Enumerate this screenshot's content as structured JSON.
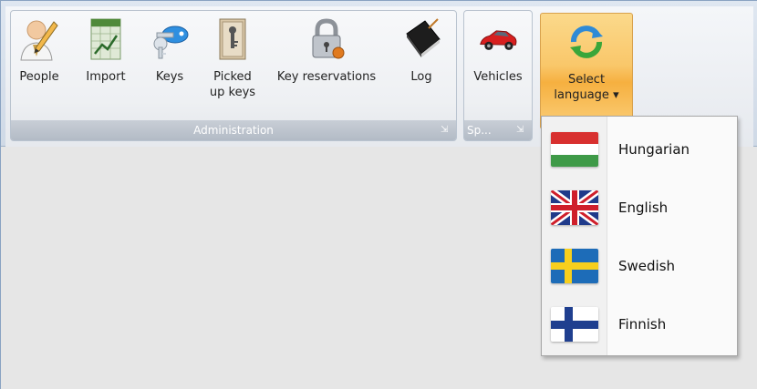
{
  "ribbon": {
    "groups": [
      {
        "label": "Administration",
        "launcher": "⇲"
      },
      {
        "label": "Sp...",
        "launcher": "⇲"
      }
    ],
    "buttons": {
      "people": "People",
      "import": "Import",
      "keys": "Keys",
      "picked_up_keys_line1": "Picked",
      "picked_up_keys_line2": "up keys",
      "key_reservations": "Key reservations",
      "log": "Log",
      "vehicles": "Vehicles",
      "select_language_line1": "Select",
      "select_language_line2": "language",
      "dropdown_arrow": "▾"
    },
    "icons": {
      "people": "person-with-pencil-icon",
      "import": "spreadsheet-chart-icon",
      "keys": "keys-icon",
      "picked_up_keys": "key-cabinet-icon",
      "key_reservations": "padlock-icon",
      "log": "notebook-icon",
      "vehicles": "red-car-icon",
      "select_language": "refresh-arrows-icon"
    }
  },
  "language_menu": {
    "items": [
      {
        "label": "Hungarian",
        "flag": "hungary-flag-icon"
      },
      {
        "label": "English",
        "flag": "uk-flag-icon"
      },
      {
        "label": "Swedish",
        "flag": "sweden-flag-icon"
      },
      {
        "label": "Finnish",
        "flag": "finland-flag-icon"
      }
    ]
  },
  "colors": {
    "selected_button": "#f9c76a",
    "group_label_bg": "#b3bbc6",
    "workspace": "#e6e6e6"
  }
}
